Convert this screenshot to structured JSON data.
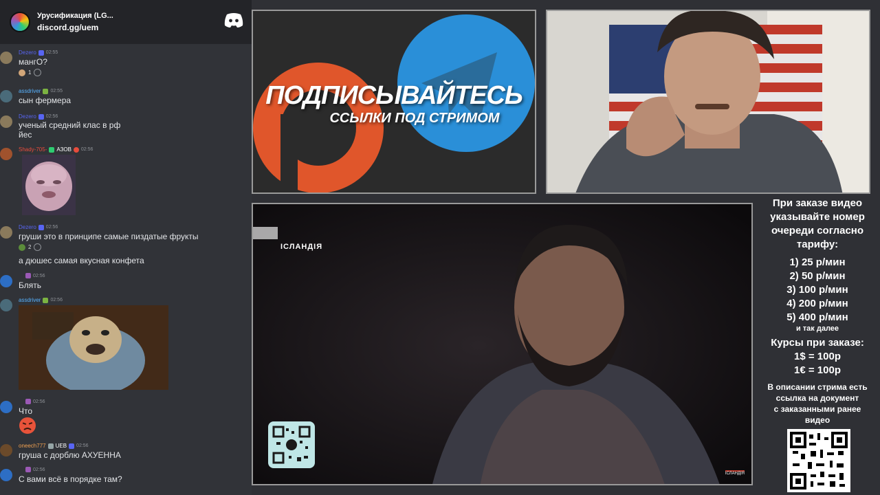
{
  "header": {
    "server_name": "Урусификация (LG...",
    "invite": "discord.gg/uem"
  },
  "messages": [
    {
      "user": "Dezero",
      "user_color": "#5865f2",
      "time": "02:55",
      "text": "мангО?",
      "reaction_count": "1"
    },
    {
      "user": "assdriver",
      "user_color": "#57b3ff",
      "time": "02:55",
      "text": "сын фермера"
    },
    {
      "user": "Dezero",
      "user_color": "#5865f2",
      "time": "02:56",
      "text": "ученый средний клас в рф",
      "text2": "йес"
    },
    {
      "user": "Shady-705-",
      "user_color": "#e74c3c",
      "tag": "АЗОВ",
      "time": "02:56"
    },
    {
      "user": "Dezero",
      "user_color": "#5865f2",
      "time": "02:56",
      "text": "груши это в принципе самые пиздатые фрукты",
      "reaction_count": "2",
      "text2": "а дюшес самая вкусная конфета"
    },
    {
      "time": "02:56",
      "text": "Блять"
    },
    {
      "user": "assdriver",
      "user_color": "#57b3ff",
      "time": "02:56"
    },
    {
      "time": "02:56",
      "text": "Что"
    },
    {
      "user": "oneech777",
      "user_color": "#f0a050",
      "tag": "UEB",
      "time": "02:56",
      "text": "груша с дорблю АХУЕННА"
    },
    {
      "time": "02:56",
      "text": "С вами всё в порядке там?"
    }
  ],
  "promo": {
    "title": "ПОДПИСЫВАЙТЕСЬ",
    "subtitle": "ССЫЛКИ ПОД СТРИМОМ"
  },
  "video": {
    "tag": "ІСЛАНДІЯ",
    "watermark": "ІСЛАНДІЯ"
  },
  "info": {
    "intro": [
      "При заказе видео",
      "указывайте номер",
      "очереди согласно",
      "тарифу:"
    ],
    "tariffs": [
      "1) 25 р/мин",
      "2) 50 р/мин",
      "3) 100 р/мин",
      "4) 200 р/мин",
      "5) 400 р/мин"
    ],
    "etc": "и так далее",
    "rates_title": "Курсы при заказе:",
    "rates": [
      "1$ = 100р",
      "1€ = 100р"
    ],
    "note": [
      "В описании стрима есть",
      "ссылка на документ",
      "с заказанными ранее",
      "видео"
    ]
  },
  "colors": {
    "chat_bg": "#313338",
    "header_bg": "#232428",
    "telegram_blue": "#2a8fd8",
    "boosty_orange": "#e0562b"
  }
}
